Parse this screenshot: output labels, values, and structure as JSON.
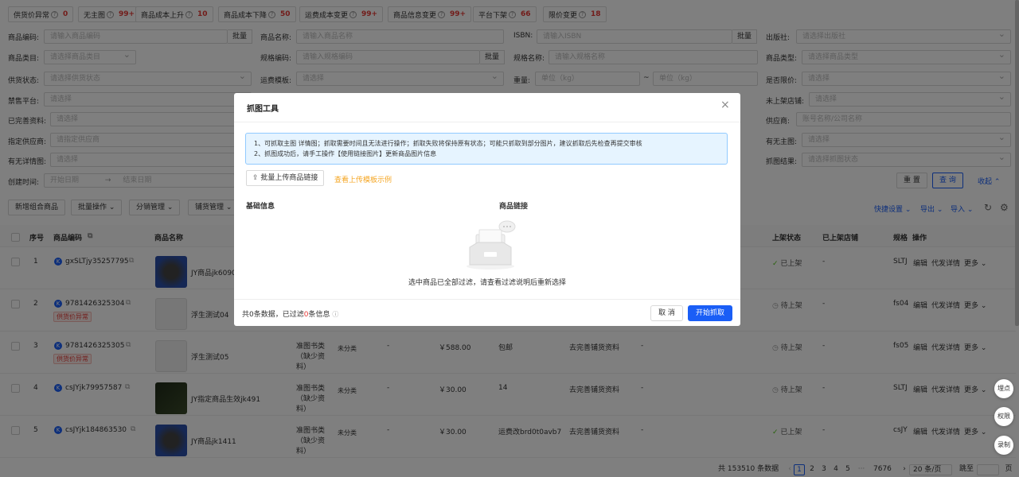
{
  "filter_tags": [
    {
      "label": "供货价异常",
      "count": "0"
    },
    {
      "label": "无主图",
      "count": "99+"
    },
    {
      "label": "商品成本上升",
      "count": "10"
    },
    {
      "label": "商品成本下降",
      "count": "50"
    },
    {
      "label": "运费成本变更",
      "count": "99+"
    },
    {
      "label": "商品信息变更",
      "count": "99+"
    },
    {
      "label": "平台下架",
      "count": "66"
    },
    {
      "label": "限价变更",
      "count": "18"
    }
  ],
  "form": {
    "product_code_label": "商品编码:",
    "product_code_ph": "请输入商品编码",
    "batch": "批量",
    "product_name_label": "商品名称:",
    "product_name_ph": "请输入商品名称",
    "isbn_label": "ISBN:",
    "isbn_ph": "请输入ISBN",
    "publisher_label": "出版社:",
    "publisher_ph": "请选择出版社",
    "category_label": "商品类目:",
    "category_ph": "请选择商品类目",
    "spec_code_label": "规格编码:",
    "spec_code_ph": "请输入规格编码",
    "spec_name_label": "规格名称:",
    "spec_name_ph": "请输入规格名称",
    "type_label": "商品类型:",
    "type_ph": "请选择商品类型",
    "supply_label": "供货状态:",
    "supply_ph": "请选择供货状态",
    "freight_label": "运费模板:",
    "freight_ph": "请选择",
    "weight_label": "重量:",
    "weight_ph": "单位（kg）",
    "weight_ph2": "单位（kg）",
    "tilde": "~",
    "limit_label": "是否限价:",
    "limit_ph": "请选择",
    "banned_label": "禁售平台:",
    "banned_ph": "请选择",
    "unlisted_label": "未上架店铺:",
    "unlisted_ph": "请选择",
    "complete_label": "已完善资料:",
    "complete_ph": "请选择",
    "supplier_label": "供应商:",
    "supplier_ph": "账号名称/公司名称",
    "assign_label": "指定供应商:",
    "assign_ph": "请指定供应商",
    "mainimg_label": "有无主图:",
    "mainimg_ph": "请选择",
    "detailimg_label": "有无详情图:",
    "detailimg_ph": "请选择",
    "grab_label": "抓图结果:",
    "grab_ph": "请选择抓图状态",
    "created_label": "创建时间:",
    "start_ph": "开始日期",
    "arrow": "→",
    "end_ph": "结束日期",
    "reset": "重 置",
    "query": "查 询",
    "collapse": "收起"
  },
  "toolbar": {
    "new_combo": "新增组合商品",
    "batch_ops": "批量操作",
    "dist_mgmt": "分销管理",
    "stock_mgmt": "铺货管理",
    "quick_settings": "快捷设置",
    "export": "导出",
    "import": "导入"
  },
  "table": {
    "headers": {
      "seq": "序号",
      "code": "商品编码",
      "name": "商品名称",
      "status": "上架状态",
      "shop": "已上架店铺",
      "spec": "规格",
      "ops": "操作"
    },
    "rows": [
      {
        "seq": "1",
        "code": "gxSLTjy35257795",
        "name": "JY商品jk6090",
        "status": "已上架",
        "shop": "-",
        "spec": "SLTJ"
      },
      {
        "seq": "2",
        "code": "9781426325304",
        "badge": "供货价异常",
        "name": "浮生测试04",
        "status": "待上架",
        "shop": "-",
        "spec": "fs04"
      },
      {
        "seq": "3",
        "code": "9781426325305",
        "badge": "供货价异常",
        "name": "浮生测试05",
        "cat": "准图书类（缺少资料）",
        "unclass": "未分类",
        "dash": "-",
        "price": "￥588.00",
        "freight": "包邮",
        "complete": "去完善铺货资料",
        "dash2": "-",
        "status": "待上架",
        "shop": "-",
        "spec": "fs05"
      },
      {
        "seq": "4",
        "code": "csJYjk79957587",
        "name": "JY指定商品生效jk491",
        "cat": "准图书类（缺少资料）",
        "unclass": "未分类",
        "dash": "-",
        "price": "￥30.00",
        "freight": "14",
        "complete": "去完善铺货资料",
        "dash2": "-",
        "status": "待上架",
        "shop": "-",
        "spec": "SLTJ"
      },
      {
        "seq": "5",
        "code": "csJYjk184863530",
        "name": "JY商品jk1411",
        "cat": "准图书类（缺少资料）",
        "unclass": "未分类",
        "dash": "-",
        "price": "￥30.00",
        "freight": "运费改brd0t0avb7",
        "complete": "去完善铺货资料",
        "dash2": "-",
        "status": "已上架",
        "shop": "-",
        "spec": "csJY"
      }
    ],
    "ops": {
      "edit": "编辑",
      "proxy": "代发详情",
      "more": "更多"
    }
  },
  "pagination": {
    "total": "共 153510 条数据",
    "pages": [
      "1",
      "2",
      "3",
      "4",
      "5"
    ],
    "ellipsis": "···",
    "last": "7676",
    "size": "20 条/页",
    "goto": "跳至",
    "page_unit": "页"
  },
  "floats": {
    "track": "埋点",
    "perm": "权限",
    "record": "录制"
  },
  "modal": {
    "title": "抓图工具",
    "notice1": "1、可抓取主图 详情图；抓取需要时间且无法进行操作；抓取失败将保持原有状态；可能只抓取到部分图片，建议抓取后先检查再提交审核",
    "notice2": "2、抓图成功后，请手工操作【使用链接图片】更新商品图片信息",
    "upload": "批量上传商品链接",
    "template": "查看上传模板示例",
    "col_basic": "基础信息",
    "col_link": "商品链接",
    "empty": "选中商品已全部过滤，请查看过滤说明后重新选择",
    "footer_prefix": "共0条数据，已过滤",
    "footer_num": "0",
    "footer_suffix": "条信息",
    "cancel": "取 消",
    "start": "开始抓取"
  },
  "colors": {
    "accent": "#1a5ef6",
    "danger": "#e53935",
    "link_orange": "#f5a623"
  }
}
